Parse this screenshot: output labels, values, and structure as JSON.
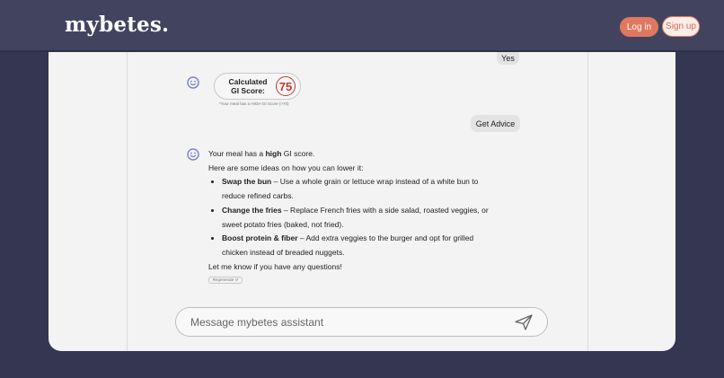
{
  "header": {
    "logo": "mybetes.",
    "login_label": "Log in",
    "signup_label": "Sign up"
  },
  "chat": {
    "user_messages": [
      "Yes",
      "Get Advice"
    ],
    "gi_card": {
      "label_line1": "Calculated",
      "label_line2": "GI Score:",
      "score": "75",
      "note": "*Your meal has a HIGH GI Score (>70)"
    },
    "advice": {
      "intro_pre": "Your meal has a ",
      "intro_bold": "high",
      "intro_post": " GI score.",
      "line2": "Here are some ideas on how you can lower it:",
      "tips": [
        {
          "title": "Swap the bun",
          "text": " – Use a whole grain or lettuce wrap instead of a white bun to reduce refined carbs."
        },
        {
          "title": "Change the fries",
          "text": " – Replace French fries with a side salad, roasted veggies, or sweet potato fries (baked, not fried)."
        },
        {
          "title": "Boost protein & fiber",
          "text": " – Add extra veggies to the burger and opt for grilled chicken instead of breaded nuggets."
        }
      ],
      "closing": "Let me know if you have any questions!",
      "regenerate_label": "Regenerate ↺"
    }
  },
  "composer": {
    "placeholder": "Message mybetes assistant"
  },
  "icons": {
    "assistant": "smiley-face-icon",
    "send": "paper-plane-icon"
  },
  "colors": {
    "accent": "#e07860",
    "header_bg": "#42445f",
    "page_bg": "#353652",
    "score_red": "#c0392b",
    "assistant_icon": "#7b7fd1"
  }
}
